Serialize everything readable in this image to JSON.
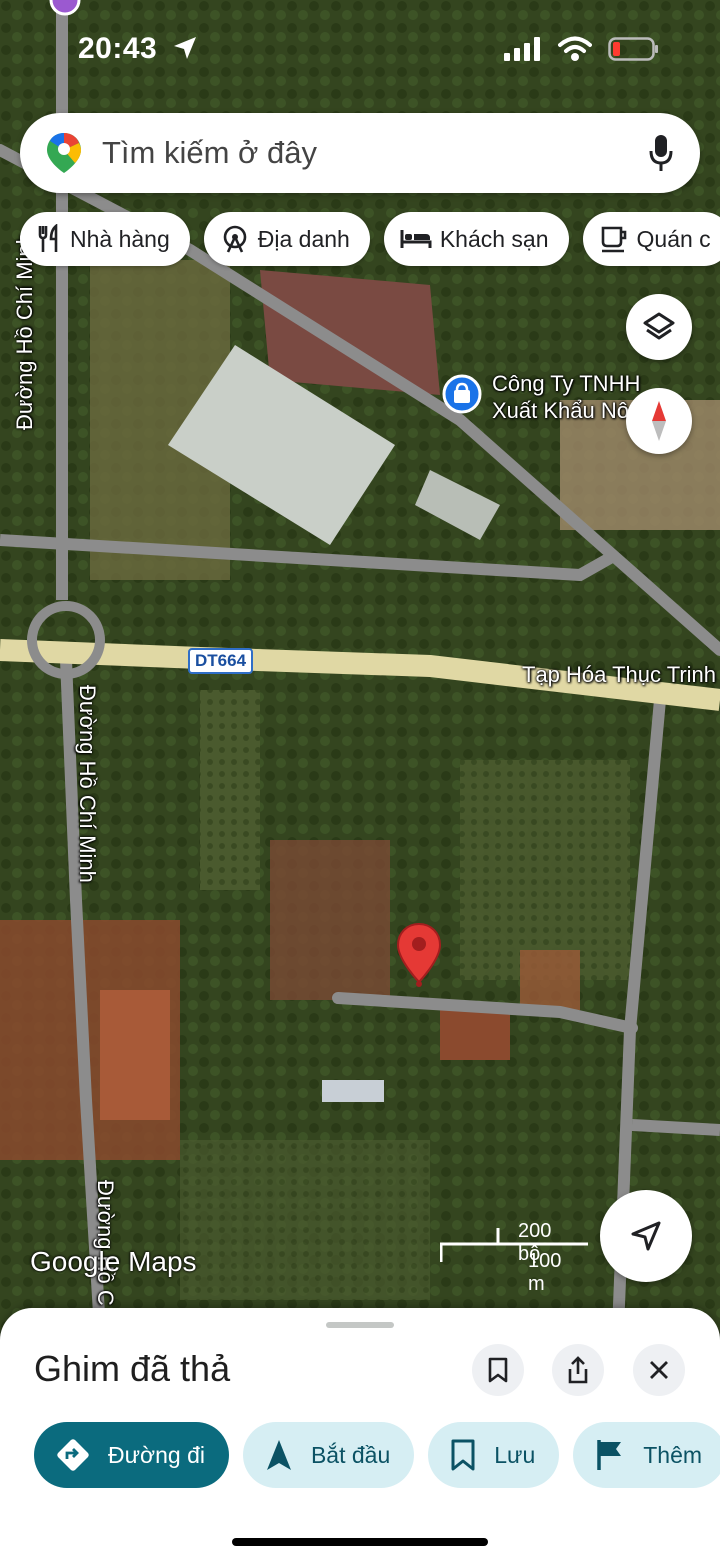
{
  "status_bar": {
    "time": "20:43"
  },
  "search": {
    "placeholder": "Tìm kiếm ở đây"
  },
  "chips": [
    {
      "label": "Nhà hàng",
      "icon": "fork-knife-icon"
    },
    {
      "label": "Địa danh",
      "icon": "ferris-wheel-icon"
    },
    {
      "label": "Khách sạn",
      "icon": "bed-icon"
    },
    {
      "label": "Quán c",
      "icon": "coffee-cup-icon"
    }
  ],
  "map": {
    "place_name_line1": "Công Ty TNHH",
    "place_name_line2": "Xuất Khẩu Nô...ản...",
    "road_badge": "DT664",
    "shop_label": "Tạp Hóa Thục Trinh",
    "road_label_top": "Đường Hồ Chí Minh",
    "road_label_mid": "Đường Hồ Chí Minh",
    "road_label_bottom": "Đường Hồ C",
    "scale_top": "200 bộ",
    "scale_bottom": "100 m",
    "attribution": "Google Maps"
  },
  "sheet": {
    "title": "Ghim đã thả",
    "actions": [
      {
        "label": "Đường đi",
        "icon": "directions-icon"
      },
      {
        "label": "Bắt đầu",
        "icon": "navigation-arrow-icon"
      },
      {
        "label": "Lưu",
        "icon": "bookmark-icon"
      },
      {
        "label": "Thêm",
        "icon": "flag-icon"
      }
    ]
  },
  "colors": {
    "accent": "#0b6b7e",
    "action_bg": "#d6eef3",
    "pin": "#e53935"
  }
}
